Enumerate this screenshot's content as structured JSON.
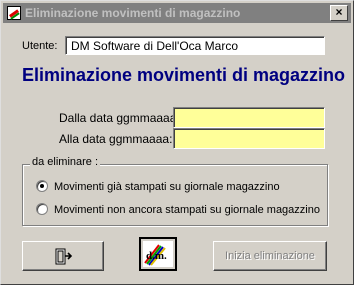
{
  "window": {
    "title": "Eliminazione movimenti di magazzino",
    "close_glyph": "×"
  },
  "form": {
    "user_label": "Utente:",
    "user_value": "DM Software di Dell'Oca Marco",
    "heading": "Eliminazione movimenti di magazzino",
    "from_date_label": "Dalla data ggmmaaaa:",
    "from_date_value": "",
    "to_date_label": "Alla data ggmmaaaa:",
    "to_date_value": ""
  },
  "group": {
    "legend": "da eliminare :",
    "options": [
      {
        "label": "Movimenti già stampati su giornale magazzino",
        "selected": true
      },
      {
        "label": "Movimenti non ancora stampati su giornale magazzino",
        "selected": false
      }
    ]
  },
  "buttons": {
    "exit_icon": "exit-door-icon",
    "logo_text": "d.m.",
    "start_label": "Inizia eliminazione",
    "start_enabled": false
  },
  "colors": {
    "date_field_bg": "#ffff99",
    "heading": "#000080",
    "titlebar_inactive": "#808080"
  }
}
